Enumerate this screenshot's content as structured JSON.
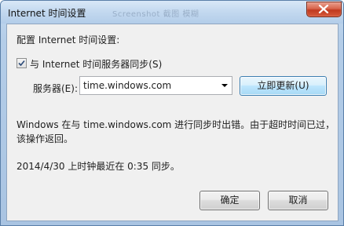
{
  "window": {
    "title": "Internet 时间设置",
    "title_ghost": "Screenshot 截图 模糊"
  },
  "content": {
    "heading": "配置 Internet 时间设置:",
    "sync_checkbox": {
      "checked": true,
      "label": "与 Internet 时间服务器同步(S)"
    },
    "server": {
      "label": "服务器(E):",
      "value": "time.windows.com"
    },
    "update_button": "立即更新(U)",
    "status_lines": [
      "Windows 在与 time.windows.com 进行同步时出错。由于超时时间已过，",
      "该操作返回。"
    ],
    "last_sync": "2014/4/30 上时钟最近在 0:35 同步。"
  },
  "buttons": {
    "ok": "确定",
    "cancel": "取消"
  },
  "icons": {
    "close": "close-icon",
    "check": "checkmark-icon",
    "dropdown": "chevron-down-icon"
  },
  "colors": {
    "titlebar": "#b9d1ea",
    "client": "#f0f0f0",
    "close_button": "#c7432a",
    "default_button_border": "#3c7fb1"
  }
}
